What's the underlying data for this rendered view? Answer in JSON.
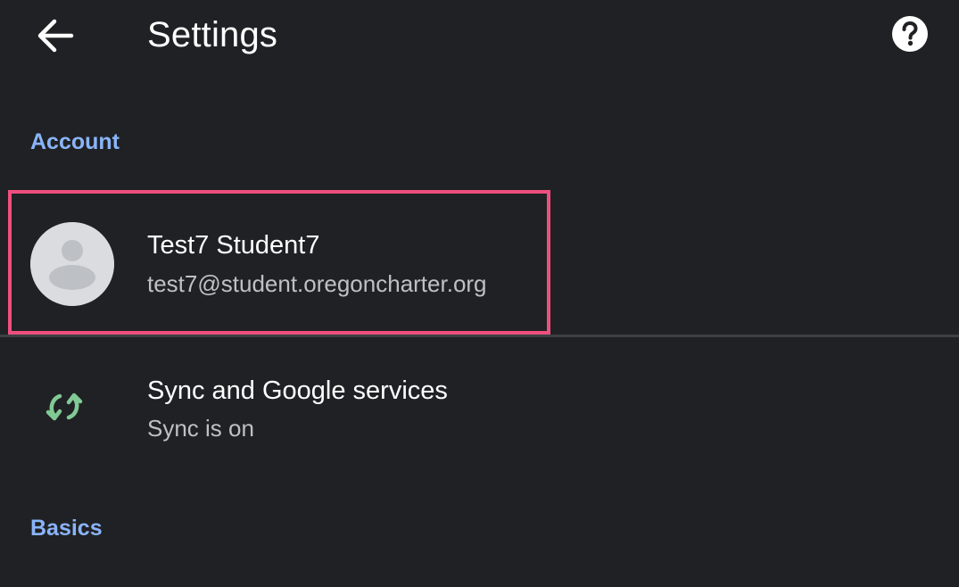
{
  "header": {
    "title": "Settings",
    "back_icon": "arrow-back-icon",
    "help_icon": "help-icon"
  },
  "sections": {
    "account": {
      "label": "Account",
      "user": {
        "name": "Test7 Student7",
        "email": "test7@student.oregoncharter.org",
        "avatar_icon": "default-avatar-icon"
      }
    },
    "sync": {
      "title": "Sync and Google services",
      "subtitle": "Sync is on",
      "icon": "sync-icon",
      "icon_color": "#81c995"
    },
    "basics": {
      "label": "Basics"
    }
  },
  "colors": {
    "background": "#202124",
    "section_header": "#8ab4f8",
    "highlight_border": "#ef4f7f",
    "secondary_text": "#bdc1c6"
  }
}
